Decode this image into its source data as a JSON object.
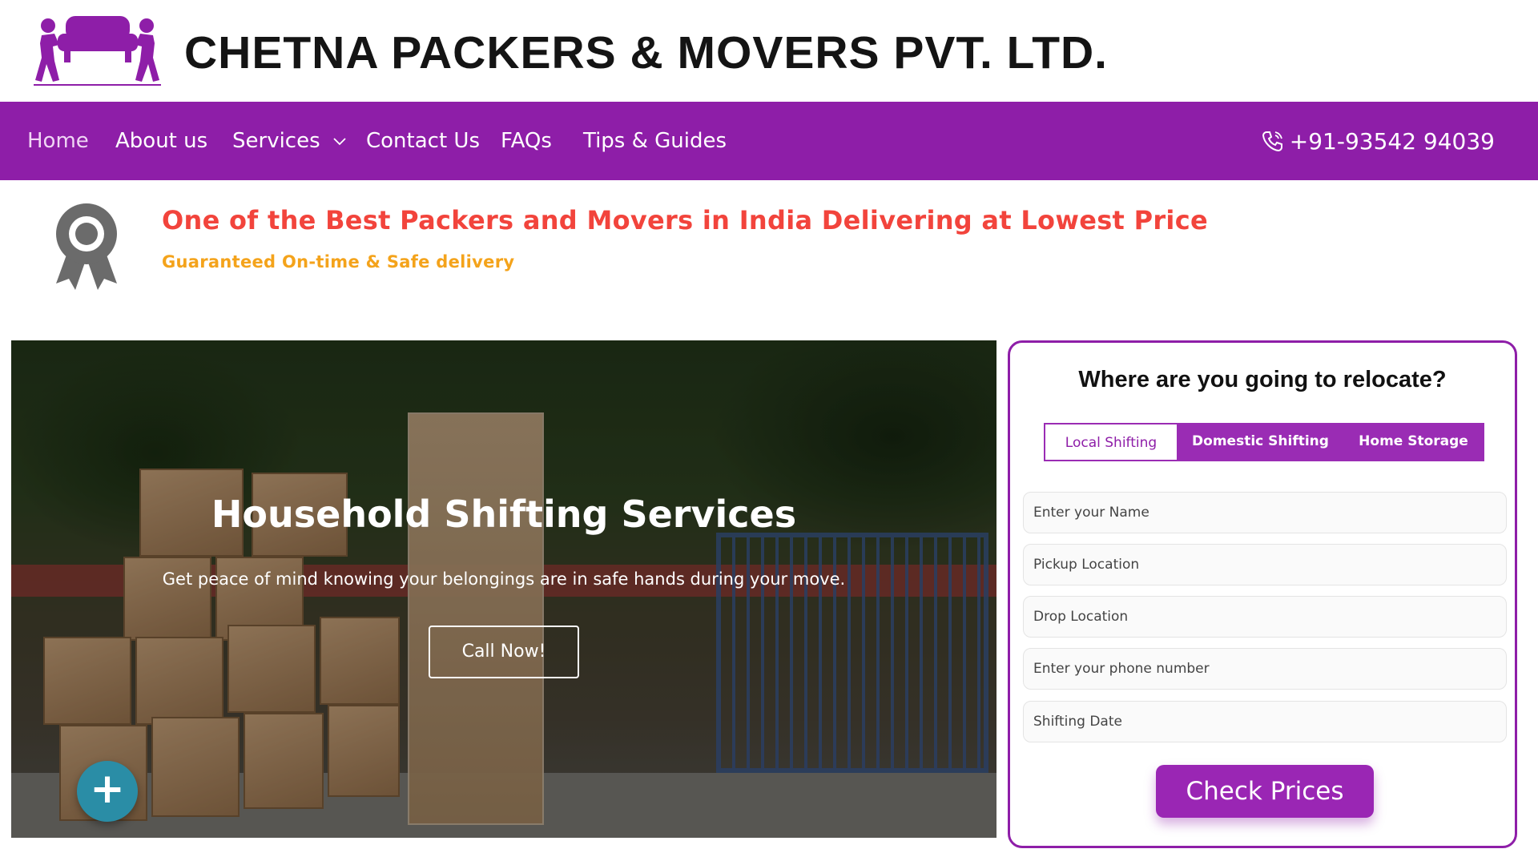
{
  "brand": {
    "name": "CHETNA PACKERS & MOVERS PVT. LTD."
  },
  "nav": {
    "items": [
      {
        "label": "Home"
      },
      {
        "label": "About us"
      },
      {
        "label": "Services"
      },
      {
        "label": "Contact Us"
      },
      {
        "label": "FAQs"
      },
      {
        "label": "Tips & Guides"
      }
    ],
    "phone": "+91-93542 94039"
  },
  "highlight": {
    "tagline": "One of the Best Packers and Movers in India Delivering at Lowest Price",
    "subtagline": "Guaranteed On-time & Safe delivery"
  },
  "hero": {
    "title": "Household Shifting Services",
    "subtitle": "Get peace of mind knowing your belongings are in safe hands during your move.",
    "cta": "Call Now!",
    "fab": "+"
  },
  "form": {
    "title": "Where are you going to relocate?",
    "tabs": [
      {
        "label": "Local Shifting",
        "active": true
      },
      {
        "label": "Domestic Shifting",
        "active": false
      },
      {
        "label": "Home Storage",
        "active": false
      }
    ],
    "fields": {
      "name": "Enter your Name",
      "pickup": "Pickup Location",
      "drop": "Drop Location",
      "phone": "Enter your phone number",
      "date": "Shifting Date"
    },
    "submit": "Check Prices"
  },
  "colors": {
    "brand_purple": "#8e1ea8",
    "tagline_red": "#f2443c",
    "subtagline_orange": "#f4a31b",
    "fab_teal": "#2a8da6"
  }
}
